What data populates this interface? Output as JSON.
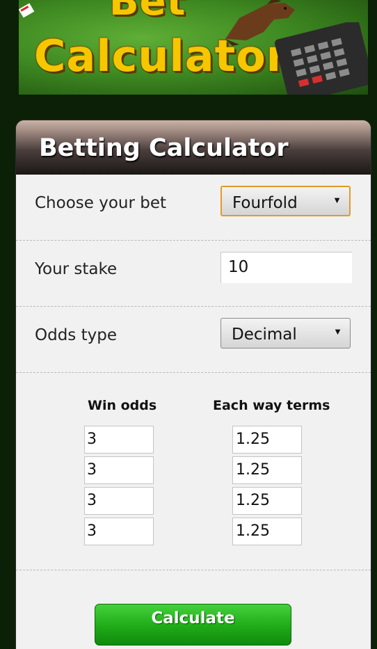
{
  "banner": {
    "line1": "Bet",
    "line2": "Calculator"
  },
  "panel": {
    "title": "Betting Calculator"
  },
  "bet_type": {
    "label": "Choose your bet",
    "value": "Fourfold"
  },
  "stake": {
    "label": "Your stake",
    "value": "10"
  },
  "odds_type": {
    "label": "Odds type",
    "value": "Decimal"
  },
  "selections": {
    "win_header": "Win odds",
    "ew_header": "Each way terms",
    "rows": [
      {
        "win": "3",
        "ew": "1.25"
      },
      {
        "win": "3",
        "ew": "1.25"
      },
      {
        "win": "3",
        "ew": "1.25"
      },
      {
        "win": "3",
        "ew": "1.25"
      }
    ]
  },
  "actions": {
    "calculate": "Calculate"
  },
  "colors": {
    "accent_green": "#1faa18",
    "focus_orange": "#e09b2a",
    "banner_yellow": "#f6c600"
  }
}
